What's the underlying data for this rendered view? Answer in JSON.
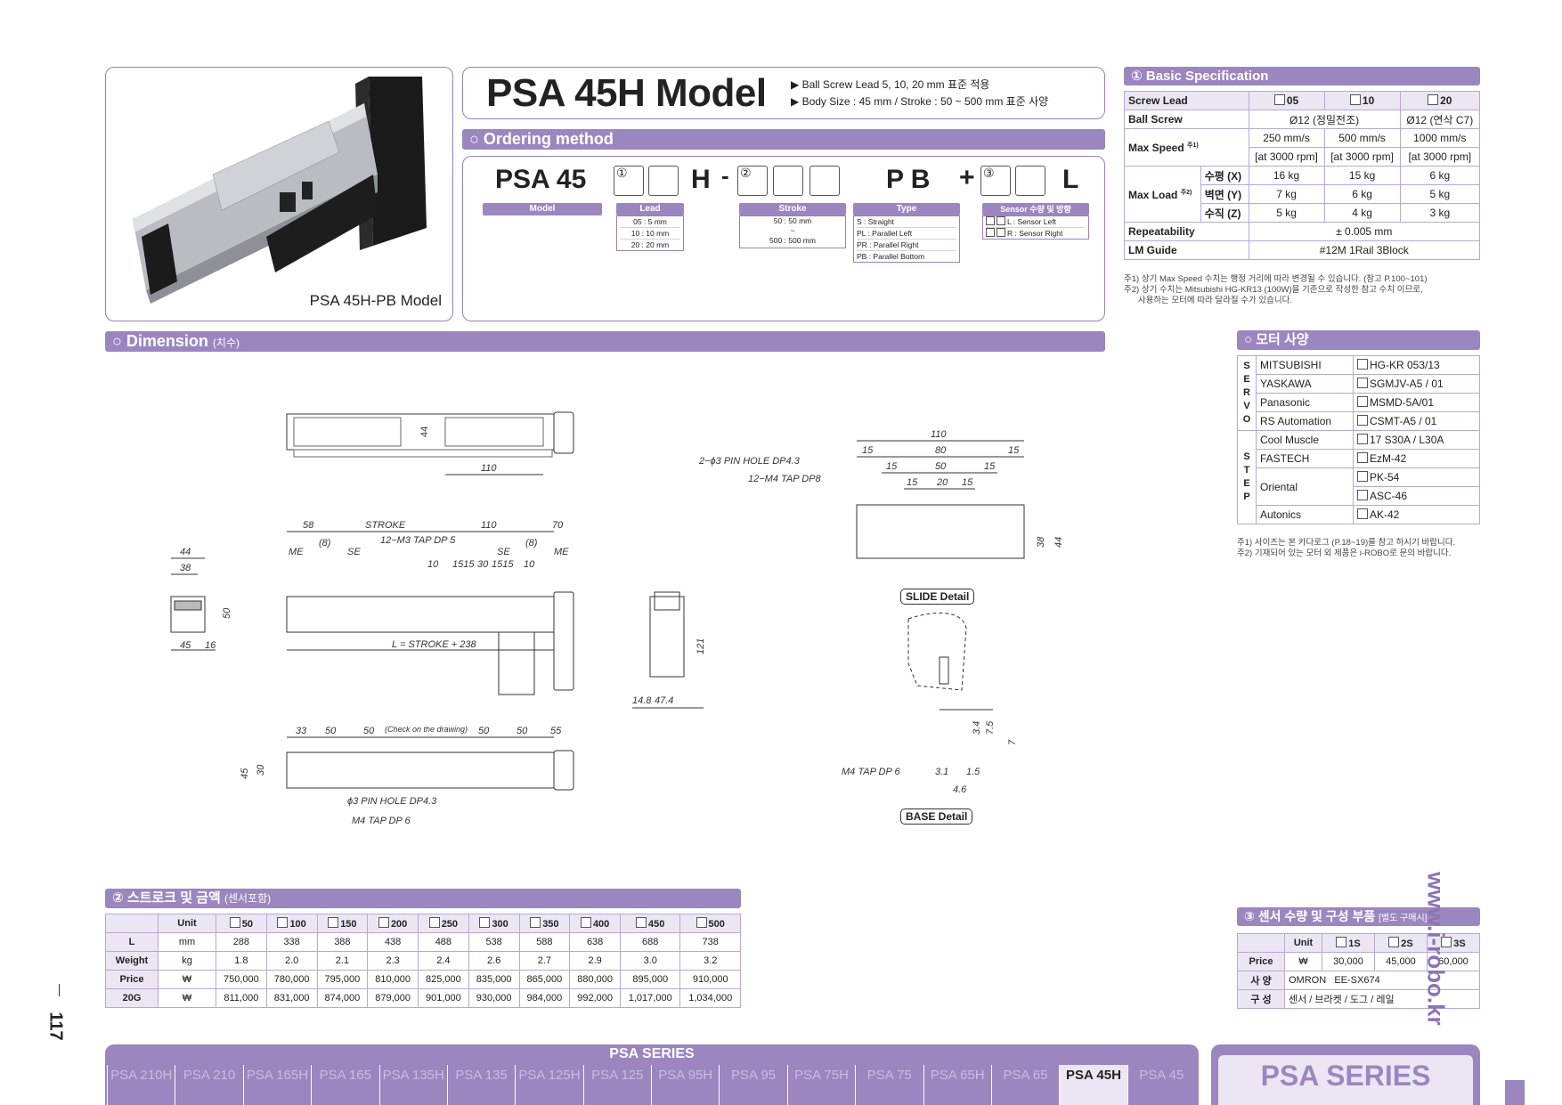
{
  "product": {
    "title": "PSA 45H Model",
    "bullets": [
      "▶ Ball Screw Lead 5, 10, 20 mm 표준 적용",
      "▶ Body Size : 45 mm / Stroke : 50 ~ 500 mm 표준 사양"
    ],
    "image_caption": "PSA 45H-PB Model"
  },
  "ordering": {
    "header": "○ Ordering method",
    "model_code": "PSA 45",
    "letter_h": "H",
    "dash": "-",
    "letters_pb": "P B",
    "plus": "+",
    "letter_l": "L",
    "circle1": "①",
    "circle2": "②",
    "circle3": "③",
    "model_label": "Model",
    "lead": {
      "header": "Lead",
      "items": [
        "05 : 5 mm",
        "10 : 10 mm",
        "20 : 20 mm"
      ]
    },
    "stroke": {
      "header": "Stroke",
      "items": [
        "50 : 50 mm",
        "~",
        "500 : 500 mm"
      ]
    },
    "type": {
      "header": "Type",
      "items": [
        "S : Straight",
        "PL : Parallel Left",
        "PR : Parallel Right",
        "PB : Parallel Bottom"
      ]
    },
    "sensor": {
      "header": "Sensor 수량 및 방향",
      "items": [
        "L : Sensor Left",
        "R : Sensor Right"
      ]
    }
  },
  "basic_spec": {
    "header": "① Basic Specification",
    "screw_lead_label": "Screw Lead",
    "leads": [
      "05",
      "10",
      "20"
    ],
    "ball_screw_label": "Ball Screw",
    "ball_screw_a": "Ø12 (정밀전조)",
    "ball_screw_b": "Ø12 (연삭 C7)",
    "max_speed_label": "Max Speed",
    "max_speed_sup": "주1)",
    "max_speed": [
      "250 mm/s",
      "500 mm/s",
      "1000 mm/s"
    ],
    "rpm": [
      "[at 3000 rpm]",
      "[at 3000 rpm]",
      "[at 3000 rpm]"
    ],
    "max_load_label": "Max Load",
    "max_load_sup": "주2)",
    "load_rows": [
      {
        "dir": "수평 (X)",
        "v": [
          "16 kg",
          "15 kg",
          "6 kg"
        ]
      },
      {
        "dir": "벽면 (Y)",
        "v": [
          "7 kg",
          "6 kg",
          "5 kg"
        ]
      },
      {
        "dir": "수직 (Z)",
        "v": [
          "5 kg",
          "4 kg",
          "3 kg"
        ]
      }
    ],
    "repeatability_label": "Repeatability",
    "repeatability": "± 0.005 mm",
    "lm_guide_label": "LM Guide",
    "lm_guide": "#12M 1Rail 3Block",
    "notes": [
      "주1) 상기 Max Speed 수치는 행정 거리에 따라 변경될 수 있습니다. (참고 P.100~101)",
      "주2) 상기 수치는 Mitsubishi HG-KR13 (100W)을 기준으로 작성한 참고 수치 이므로,",
      "      사용하는 모터에 따라 달라질 수가 있습니다."
    ]
  },
  "dimension": {
    "header": "○ Dimension",
    "header_small": "(치수)",
    "slide_caption": "SLIDE Detail",
    "base_caption": "BASE Detail",
    "labels": {
      "d44": "44",
      "d110": "110",
      "d58": "58",
      "stroke": "STROKE",
      "d70": "70",
      "me": "ME",
      "se": "SE",
      "p8": "(8)",
      "m3": "12−M3 TAP DP 5",
      "d10": "10",
      "d1515": "1515",
      "d30": "30",
      "d45": "45",
      "d50": "50",
      "d38": "38",
      "d16": "16",
      "lform": "L = STROKE + 238",
      "d121": "121",
      "d148": "14.8",
      "d474": "47.4",
      "pin3": "2−ϕ3 PIN HOLE DP4.3",
      "m4dp8": "12−M4 TAP DP8",
      "d15": "15",
      "d80": "80",
      "d20": "20",
      "d33": "33",
      "d55": "55",
      "check": "(Check on the drawing)",
      "d30b": "30",
      "pinb": "ϕ3 PIN HOLE DP4.3",
      "m4dp6": "M4 TAP DP 6",
      "d31": "3.1",
      "d15b": "1.5",
      "d46": "4.6",
      "d34": "3.4",
      "d75": "7.5",
      "d7": "7"
    }
  },
  "motor": {
    "header": "○ 모터 사양",
    "servo_label": "SERVO",
    "step_label": "STEP",
    "servo": [
      [
        "MITSUBISHI",
        "HG-KR 053/13"
      ],
      [
        "YASKAWA",
        "SGMJV-A5 / 01"
      ],
      [
        "Panasonic",
        "MSMD-5A/01"
      ],
      [
        "RS Automation",
        "CSMT-A5 / 01"
      ]
    ],
    "step": [
      [
        "Cool Muscle",
        "17 S30A / L30A"
      ],
      [
        "FASTECH",
        "EzM-42"
      ],
      [
        "Oriental",
        "PK-54"
      ],
      [
        "",
        "ASC-46"
      ],
      [
        "Autonics",
        "AK-42"
      ]
    ],
    "notes": [
      "주1) 사이즈는 본 카다로그 (P.18~19)를 참고 하시기 바랍니다.",
      "주2) 기재되어 있는 모터 외 제품은 i-ROBO로 문의 바랍니다."
    ]
  },
  "stroke_price": {
    "header": "② 스트로크 및 금액",
    "header_small": "(센서포함)",
    "unit_label": "Unit",
    "strokes": [
      "50",
      "100",
      "150",
      "200",
      "250",
      "300",
      "350",
      "400",
      "450",
      "500"
    ],
    "rows": [
      {
        "label": "L",
        "unit": "mm",
        "v": [
          "288",
          "338",
          "388",
          "438",
          "488",
          "538",
          "588",
          "638",
          "688",
          "738"
        ]
      },
      {
        "label": "Weight",
        "unit": "kg",
        "v": [
          "1.8",
          "2.0",
          "2.1",
          "2.3",
          "2.4",
          "2.6",
          "2.7",
          "2.9",
          "3.0",
          "3.2"
        ]
      },
      {
        "label": "Price",
        "unit": "₩",
        "v": [
          "750,000",
          "780,000",
          "795,000",
          "810,000",
          "825,000",
          "835,000",
          "865,000",
          "880,000",
          "895,000",
          "910,000"
        ]
      },
      {
        "label": "20G",
        "unit": "₩",
        "v": [
          "811,000",
          "831,000",
          "874,000",
          "879,000",
          "901,000",
          "930,000",
          "984,000",
          "992,000",
          "1,017,000",
          "1,034,000"
        ]
      }
    ]
  },
  "sensor": {
    "header": "③ 센서 수량 및 구성 부품",
    "header_small": "[별도 구매시]",
    "unit_label": "Unit",
    "cols": [
      "1S",
      "2S",
      "3S"
    ],
    "price_label": "Price",
    "price_unit": "₩",
    "prices": [
      "30,000",
      "45,000",
      "60,000"
    ],
    "spec_label": "사 양",
    "spec_value": "OMRON   EE-SX674",
    "config_label": "구 성",
    "config_value": "센서 / 브라켓 / 도그 / 레일"
  },
  "footer": {
    "page_number": "117",
    "side_url": "www.i-robo.kr",
    "series_title": "PSA SERIES",
    "series_tabs": [
      "PSA 210H",
      "PSA 210",
      "PSA 165H",
      "PSA 165",
      "PSA 135H",
      "PSA 135",
      "PSA 125H",
      "PSA 125",
      "PSA 95H",
      "PSA 95",
      "PSA 75H",
      "PSA 75",
      "PSA 65H",
      "PSA 65",
      "PSA 45H",
      "PSA 45"
    ],
    "active_tab": "PSA 45H",
    "right_badge": "PSA SERIES"
  },
  "colors": {
    "accent": "#9b86c0",
    "accent_light": "#ece6f4",
    "border": "#9a7fb8"
  }
}
